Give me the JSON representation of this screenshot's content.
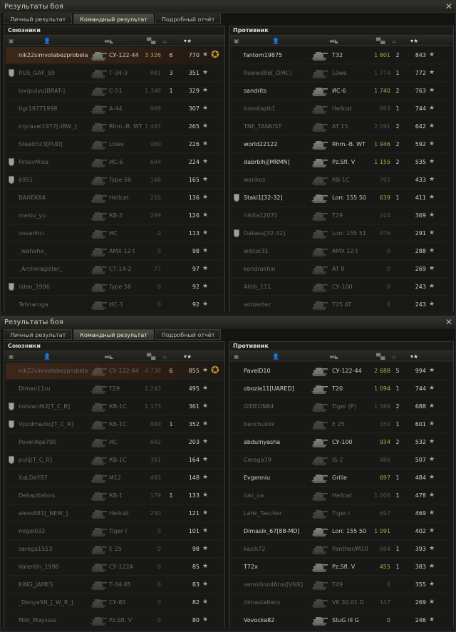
{
  "windows": [
    {
      "title": "Результаты боя",
      "close_icon": "close-icon",
      "tabs": [
        "Личный результат",
        "Командный результат",
        "Подробный отчёт"
      ],
      "active_tab": 1,
      "allies": {
        "title": "Союзники",
        "rows": [
          {
            "player": "nik22simvolabezprobela..",
            "tank": "СУ-122-44",
            "damage": "3 326",
            "frags": "6",
            "xp": "770",
            "me": true,
            "dead": false,
            "medal": false,
            "tag_icon": "rank-insignia-icon"
          },
          {
            "player": "RUS_GAF_59",
            "tank": "Т-34-3",
            "damage": "881",
            "frags": "3",
            "xp": "351",
            "dead": true,
            "medal": true
          },
          {
            "player": "lovipulyu[BRAT-]",
            "tank": "С-51",
            "damage": "1 348",
            "frags": "1",
            "xp": "329",
            "dead": true,
            "medal": false
          },
          {
            "player": "tigr19771998",
            "tank": "А-44",
            "damage": "969",
            "frags": "",
            "xp": "307",
            "dead": true,
            "medal": false
          },
          {
            "player": "myravei1977[-IRW_]",
            "tank": "Rhm.-B. WT",
            "damage": "1 497",
            "frags": "",
            "xp": "265",
            "dead": true,
            "medal": false
          },
          {
            "player": "Stealth23[PUD]",
            "tank": "Löwe",
            "damage": "960",
            "frags": "",
            "xp": "226",
            "dead": true,
            "medal": false
          },
          {
            "player": "FirsovMixa",
            "tank": "ИС-6",
            "damage": "694",
            "frags": "",
            "xp": "224",
            "dead": true,
            "medal": true
          },
          {
            "player": "6951",
            "tank": "Type 58",
            "damage": "148",
            "frags": "",
            "xp": "165",
            "dead": true,
            "medal": true
          },
          {
            "player": "ВАНЕК84",
            "tank": "Hellcat",
            "damage": "210",
            "frags": "",
            "xp": "136",
            "dead": true,
            "medal": false
          },
          {
            "player": "malov_yu",
            "tank": "КВ-2",
            "damage": "299",
            "frags": "",
            "xp": "126",
            "dead": true,
            "medal": false
          },
          {
            "player": "vovanhci",
            "tank": "ИС",
            "damage": "0",
            "frags": "",
            "xp": "113",
            "dead": true,
            "medal": false
          },
          {
            "player": "_wahaha_",
            "tank": "AMX 12 t",
            "damage": "0",
            "frags": "",
            "xp": "98",
            "dead": true,
            "medal": false
          },
          {
            "player": "_Archmagister_",
            "tank": "СТ-14-2",
            "damage": "77",
            "frags": "",
            "xp": "97",
            "dead": true,
            "medal": false
          },
          {
            "player": "lidan_1996",
            "tank": "Type 58",
            "damage": "0",
            "frags": "",
            "xp": "92",
            "dead": true,
            "medal": true
          },
          {
            "player": "Tehnaruga",
            "tank": "ИС-3",
            "damage": "0",
            "frags": "",
            "xp": "92",
            "dead": true,
            "medal": false
          }
        ]
      },
      "enemies": {
        "title": "Противник",
        "rows": [
          {
            "player": "fantom19875",
            "tank": "T32",
            "damage": "1 801",
            "frags": "2",
            "xp": "843",
            "dead": false,
            "medal": false
          },
          {
            "player": "Rowwd86[_DMC]",
            "tank": "Löwe",
            "damage": "1 774",
            "frags": "1",
            "xp": "772",
            "dead": true,
            "medal": false
          },
          {
            "player": "sandrits",
            "tank": "ИС-6",
            "damage": "1 740",
            "frags": "2",
            "xp": "763",
            "dead": false,
            "medal": false
          },
          {
            "player": "bronitazik1",
            "tank": "Hellcat",
            "damage": "993",
            "frags": "1",
            "xp": "744",
            "dead": true,
            "medal": false
          },
          {
            "player": "TNE_TANKIST",
            "tank": "AT 15",
            "damage": "2 091",
            "frags": "2",
            "xp": "642",
            "dead": true,
            "medal": false
          },
          {
            "player": "world22122",
            "tank": "Rhm.-B. WT",
            "damage": "1 946",
            "frags": "2",
            "xp": "592",
            "dead": false,
            "medal": false
          },
          {
            "player": "dabrblhj[MRMN]",
            "tank": "Pz.Sfl. V",
            "damage": "1 155",
            "frags": "2",
            "xp": "535",
            "dead": false,
            "medal": false
          },
          {
            "player": "werikos",
            "tank": "КВ-1С",
            "damage": "792",
            "frags": "",
            "xp": "433",
            "dead": true,
            "medal": false
          },
          {
            "player": "Staki1[32-32]",
            "tank": "Lorr. 155 50",
            "damage": "639",
            "frags": "1",
            "xp": "411",
            "dead": false,
            "medal": true
          },
          {
            "player": "nikita12071",
            "tank": "T29",
            "damage": "244",
            "frags": "",
            "xp": "369",
            "dead": true,
            "medal": false
          },
          {
            "player": "Dallass[32-32]",
            "tank": "Lorr. 155 51",
            "damage": "476",
            "frags": "",
            "xp": "291",
            "dead": true,
            "medal": true
          },
          {
            "player": "wiktor31",
            "tank": "AMX 12 t",
            "damage": "0",
            "frags": "",
            "xp": "288",
            "dead": true,
            "medal": false
          },
          {
            "player": "kondrakhin",
            "tank": "AT 8",
            "damage": "0",
            "frags": "",
            "xp": "269",
            "dead": true,
            "medal": false
          },
          {
            "player": "Alish_111",
            "tank": "СУ-100",
            "damage": "0",
            "frags": "",
            "xp": "243",
            "dead": true,
            "medal": false
          },
          {
            "player": "ambertec",
            "tank": "T25 AT",
            "damage": "0",
            "frags": "",
            "xp": "243",
            "dead": true,
            "medal": false
          }
        ]
      }
    },
    {
      "title": "Результаты боя",
      "close_icon": "close-icon",
      "tabs": [
        "Личный результат",
        "Командный результат",
        "Подробный отчёт"
      ],
      "active_tab": 1,
      "allies": {
        "title": "Союзники",
        "rows": [
          {
            "player": "nik22simvolabezprobela..",
            "tank": "СУ-122-44",
            "damage": "4 738",
            "frags": "6",
            "xp": "855",
            "me": true,
            "dead": true,
            "medal": false,
            "tag_icon": "rank-insignia-icon"
          },
          {
            "player": "Diman11ru",
            "tank": "T29",
            "damage": "1 243",
            "frags": "",
            "xp": "495",
            "dead": true,
            "medal": false
          },
          {
            "player": "kobzard92[T_C_R]",
            "tank": "КВ-1С",
            "damage": "1 173",
            "frags": "",
            "xp": "361",
            "dead": true,
            "medal": true
          },
          {
            "player": "Vpodmazko[T_C_R]",
            "tank": "КВ-1С",
            "damage": "889",
            "frags": "1",
            "xp": "352",
            "dead": true,
            "medal": true
          },
          {
            "player": "PoverAge700",
            "tank": "ИС",
            "damage": "842",
            "frags": "",
            "xp": "203",
            "dead": true,
            "medal": false
          },
          {
            "player": "pullj[T_C_R]",
            "tank": "КВ-1С",
            "damage": "391",
            "frags": "",
            "xp": "164",
            "dead": true,
            "medal": true
          },
          {
            "player": "XaLDeY87",
            "tank": "M12",
            "damage": "493",
            "frags": "",
            "xp": "148",
            "dead": true,
            "medal": false
          },
          {
            "player": "Dekapitators",
            "tank": "КВ-1",
            "damage": "179",
            "frags": "1",
            "xp": "133",
            "dead": true,
            "medal": false
          },
          {
            "player": "alexs681[_NEW_]",
            "tank": "Hellcat",
            "damage": "250",
            "frags": "",
            "xp": "121",
            "dead": true,
            "medal": false
          },
          {
            "player": "migel032",
            "tank": "Tiger I",
            "damage": "0",
            "frags": "",
            "xp": "101",
            "dead": true,
            "medal": false
          },
          {
            "player": "serega1513",
            "tank": "E 25",
            "damage": "0",
            "frags": "",
            "xp": "98",
            "dead": true,
            "medal": false
          },
          {
            "player": "Valentin_1998",
            "tank": "СУ-122А",
            "damage": "0",
            "frags": "",
            "xp": "85",
            "dead": true,
            "medal": false
          },
          {
            "player": "KING_JAMES",
            "tank": "Т-34-85",
            "damage": "0",
            "frags": "",
            "xp": "83",
            "dead": true,
            "medal": false
          },
          {
            "player": "_DenyaSN_[_W_R_]",
            "tank": "СУ-85",
            "damage": "0",
            "frags": "",
            "xp": "82",
            "dead": true,
            "medal": false
          },
          {
            "player": "Miki_Mayssss",
            "tank": "Pz.Sfl. V",
            "damage": "0",
            "frags": "",
            "xp": "80",
            "dead": true,
            "medal": false
          }
        ]
      },
      "enemies": {
        "title": "Противник",
        "rows": [
          {
            "player": "PavelD10",
            "tank": "СУ-122-44",
            "damage": "2 688",
            "frags": "5",
            "xp": "994",
            "dead": false,
            "medal": false
          },
          {
            "player": "obozia11[UARED]",
            "tank": "T20",
            "damage": "1 094",
            "frags": "1",
            "xp": "744",
            "dead": false,
            "medal": false
          },
          {
            "player": "GIDEON84",
            "tank": "Tiger (P)",
            "damage": "1 389",
            "frags": "2",
            "xp": "688",
            "dead": true,
            "medal": false
          },
          {
            "player": "benchukkk",
            "tank": "E 25",
            "damage": "350",
            "frags": "1",
            "xp": "601",
            "dead": true,
            "medal": false
          },
          {
            "player": "abdulnyasha",
            "tank": "СУ-100",
            "damage": "934",
            "frags": "2",
            "xp": "532",
            "dead": false,
            "medal": false
          },
          {
            "player": "Cerega79",
            "tank": "IS-2",
            "damage": "486",
            "frags": "",
            "xp": "507",
            "dead": true,
            "medal": false
          },
          {
            "player": "Evgenniu",
            "tank": "Grille",
            "damage": "697",
            "frags": "1",
            "xp": "484",
            "dead": false,
            "medal": false
          },
          {
            "player": "luki_ua",
            "tank": "Hellcat",
            "damage": "1 006",
            "frags": "1",
            "xp": "478",
            "dead": true,
            "medal": false
          },
          {
            "player": "Lank_Tascher",
            "tank": "Tiger I",
            "damage": "697",
            "frags": "",
            "xp": "469",
            "dead": true,
            "medal": false
          },
          {
            "player": "Dimasik_67[88-MD]",
            "tank": "Lorr. 155 50",
            "damage": "1 091",
            "frags": "",
            "xp": "402",
            "dead": false,
            "medal": false
          },
          {
            "player": "kasik72",
            "tank": "Panther/M10",
            "damage": "684",
            "frags": "1",
            "xp": "393",
            "dead": true,
            "medal": false
          },
          {
            "player": "T72x",
            "tank": "Pz.Sfl. V",
            "damage": "455",
            "frags": "1",
            "xp": "383",
            "dead": false,
            "medal": false
          },
          {
            "player": "vermilion46rus[VNX]",
            "tank": "T49",
            "damage": "0",
            "frags": "",
            "xp": "355",
            "dead": true,
            "medal": false
          },
          {
            "player": "dimastalkers",
            "tank": "VK 30.01 D",
            "damage": "147",
            "frags": "",
            "xp": "269",
            "dead": true,
            "medal": false
          },
          {
            "player": "Vovocka82",
            "tank": "StuG III G",
            "damage": "0",
            "frags": "",
            "xp": "246",
            "dead": false,
            "medal": false
          }
        ]
      }
    }
  ],
  "column_icons": [
    "platoon-icon",
    "player-icon",
    "tank-icon",
    "damage-icon",
    "frags-icon",
    "xp-star-icon"
  ]
}
